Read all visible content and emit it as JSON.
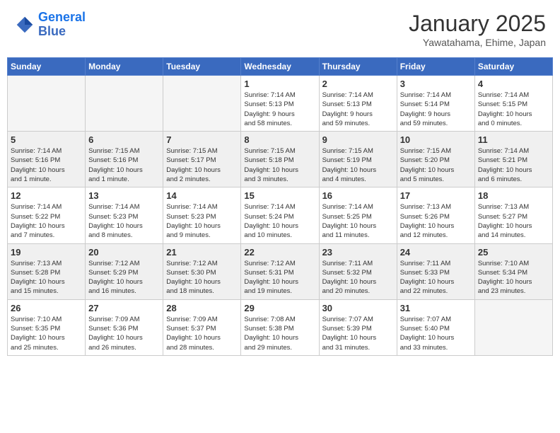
{
  "header": {
    "logo_line1": "General",
    "logo_line2": "Blue",
    "month": "January 2025",
    "location": "Yawatahama, Ehime, Japan"
  },
  "weekdays": [
    "Sunday",
    "Monday",
    "Tuesday",
    "Wednesday",
    "Thursday",
    "Friday",
    "Saturday"
  ],
  "weeks": [
    {
      "shaded": false,
      "days": [
        {
          "num": "",
          "info": ""
        },
        {
          "num": "",
          "info": ""
        },
        {
          "num": "",
          "info": ""
        },
        {
          "num": "1",
          "info": "Sunrise: 7:14 AM\nSunset: 5:13 PM\nDaylight: 9 hours\nand 58 minutes."
        },
        {
          "num": "2",
          "info": "Sunrise: 7:14 AM\nSunset: 5:13 PM\nDaylight: 9 hours\nand 59 minutes."
        },
        {
          "num": "3",
          "info": "Sunrise: 7:14 AM\nSunset: 5:14 PM\nDaylight: 9 hours\nand 59 minutes."
        },
        {
          "num": "4",
          "info": "Sunrise: 7:14 AM\nSunset: 5:15 PM\nDaylight: 10 hours\nand 0 minutes."
        }
      ]
    },
    {
      "shaded": true,
      "days": [
        {
          "num": "5",
          "info": "Sunrise: 7:14 AM\nSunset: 5:16 PM\nDaylight: 10 hours\nand 1 minute."
        },
        {
          "num": "6",
          "info": "Sunrise: 7:15 AM\nSunset: 5:16 PM\nDaylight: 10 hours\nand 1 minute."
        },
        {
          "num": "7",
          "info": "Sunrise: 7:15 AM\nSunset: 5:17 PM\nDaylight: 10 hours\nand 2 minutes."
        },
        {
          "num": "8",
          "info": "Sunrise: 7:15 AM\nSunset: 5:18 PM\nDaylight: 10 hours\nand 3 minutes."
        },
        {
          "num": "9",
          "info": "Sunrise: 7:15 AM\nSunset: 5:19 PM\nDaylight: 10 hours\nand 4 minutes."
        },
        {
          "num": "10",
          "info": "Sunrise: 7:15 AM\nSunset: 5:20 PM\nDaylight: 10 hours\nand 5 minutes."
        },
        {
          "num": "11",
          "info": "Sunrise: 7:14 AM\nSunset: 5:21 PM\nDaylight: 10 hours\nand 6 minutes."
        }
      ]
    },
    {
      "shaded": false,
      "days": [
        {
          "num": "12",
          "info": "Sunrise: 7:14 AM\nSunset: 5:22 PM\nDaylight: 10 hours\nand 7 minutes."
        },
        {
          "num": "13",
          "info": "Sunrise: 7:14 AM\nSunset: 5:23 PM\nDaylight: 10 hours\nand 8 minutes."
        },
        {
          "num": "14",
          "info": "Sunrise: 7:14 AM\nSunset: 5:23 PM\nDaylight: 10 hours\nand 9 minutes."
        },
        {
          "num": "15",
          "info": "Sunrise: 7:14 AM\nSunset: 5:24 PM\nDaylight: 10 hours\nand 10 minutes."
        },
        {
          "num": "16",
          "info": "Sunrise: 7:14 AM\nSunset: 5:25 PM\nDaylight: 10 hours\nand 11 minutes."
        },
        {
          "num": "17",
          "info": "Sunrise: 7:13 AM\nSunset: 5:26 PM\nDaylight: 10 hours\nand 12 minutes."
        },
        {
          "num": "18",
          "info": "Sunrise: 7:13 AM\nSunset: 5:27 PM\nDaylight: 10 hours\nand 14 minutes."
        }
      ]
    },
    {
      "shaded": true,
      "days": [
        {
          "num": "19",
          "info": "Sunrise: 7:13 AM\nSunset: 5:28 PM\nDaylight: 10 hours\nand 15 minutes."
        },
        {
          "num": "20",
          "info": "Sunrise: 7:12 AM\nSunset: 5:29 PM\nDaylight: 10 hours\nand 16 minutes."
        },
        {
          "num": "21",
          "info": "Sunrise: 7:12 AM\nSunset: 5:30 PM\nDaylight: 10 hours\nand 18 minutes."
        },
        {
          "num": "22",
          "info": "Sunrise: 7:12 AM\nSunset: 5:31 PM\nDaylight: 10 hours\nand 19 minutes."
        },
        {
          "num": "23",
          "info": "Sunrise: 7:11 AM\nSunset: 5:32 PM\nDaylight: 10 hours\nand 20 minutes."
        },
        {
          "num": "24",
          "info": "Sunrise: 7:11 AM\nSunset: 5:33 PM\nDaylight: 10 hours\nand 22 minutes."
        },
        {
          "num": "25",
          "info": "Sunrise: 7:10 AM\nSunset: 5:34 PM\nDaylight: 10 hours\nand 23 minutes."
        }
      ]
    },
    {
      "shaded": false,
      "days": [
        {
          "num": "26",
          "info": "Sunrise: 7:10 AM\nSunset: 5:35 PM\nDaylight: 10 hours\nand 25 minutes."
        },
        {
          "num": "27",
          "info": "Sunrise: 7:09 AM\nSunset: 5:36 PM\nDaylight: 10 hours\nand 26 minutes."
        },
        {
          "num": "28",
          "info": "Sunrise: 7:09 AM\nSunset: 5:37 PM\nDaylight: 10 hours\nand 28 minutes."
        },
        {
          "num": "29",
          "info": "Sunrise: 7:08 AM\nSunset: 5:38 PM\nDaylight: 10 hours\nand 29 minutes."
        },
        {
          "num": "30",
          "info": "Sunrise: 7:07 AM\nSunset: 5:39 PM\nDaylight: 10 hours\nand 31 minutes."
        },
        {
          "num": "31",
          "info": "Sunrise: 7:07 AM\nSunset: 5:40 PM\nDaylight: 10 hours\nand 33 minutes."
        },
        {
          "num": "",
          "info": ""
        }
      ]
    }
  ]
}
